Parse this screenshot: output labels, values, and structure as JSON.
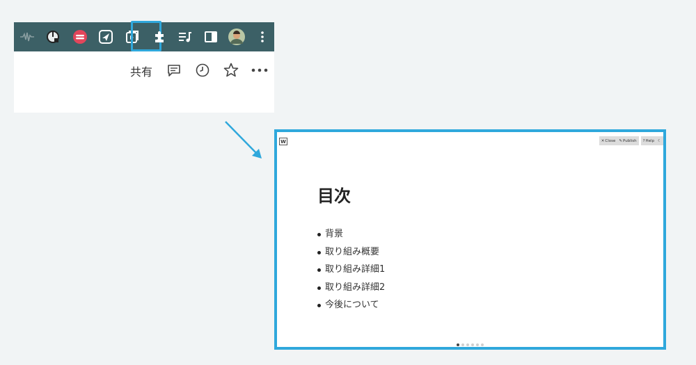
{
  "toolbar": {
    "icons": [
      {
        "name": "audio-wave-icon"
      },
      {
        "name": "power-timer-icon"
      },
      {
        "name": "red-circle-extension-icon"
      },
      {
        "name": "send-arrow-icon"
      },
      {
        "name": "slide-play-icon",
        "highlighted": true
      },
      {
        "name": "puzzle-extensions-icon"
      },
      {
        "name": "playlist-icon"
      },
      {
        "name": "sidebar-panel-icon"
      },
      {
        "name": "profile-avatar"
      },
      {
        "name": "kebab-menu-icon"
      }
    ],
    "colors": {
      "background": "#3c6066",
      "highlight": "#2fa8dc"
    }
  },
  "page_header": {
    "share_label": "共有",
    "icons": [
      "comment-icon",
      "history-clock-icon",
      "star-icon",
      "more-horizontal-icon"
    ]
  },
  "slide": {
    "logo_text": "W",
    "controls": {
      "close_label": "Close",
      "publish_label": "Publish",
      "help_label": "Help"
    },
    "title": "目次",
    "items": [
      "背景",
      "取り組み概要",
      "取り組み詳細1",
      "取り組み詳細2",
      "今後について"
    ],
    "page_count": 6,
    "current_page": 1
  }
}
